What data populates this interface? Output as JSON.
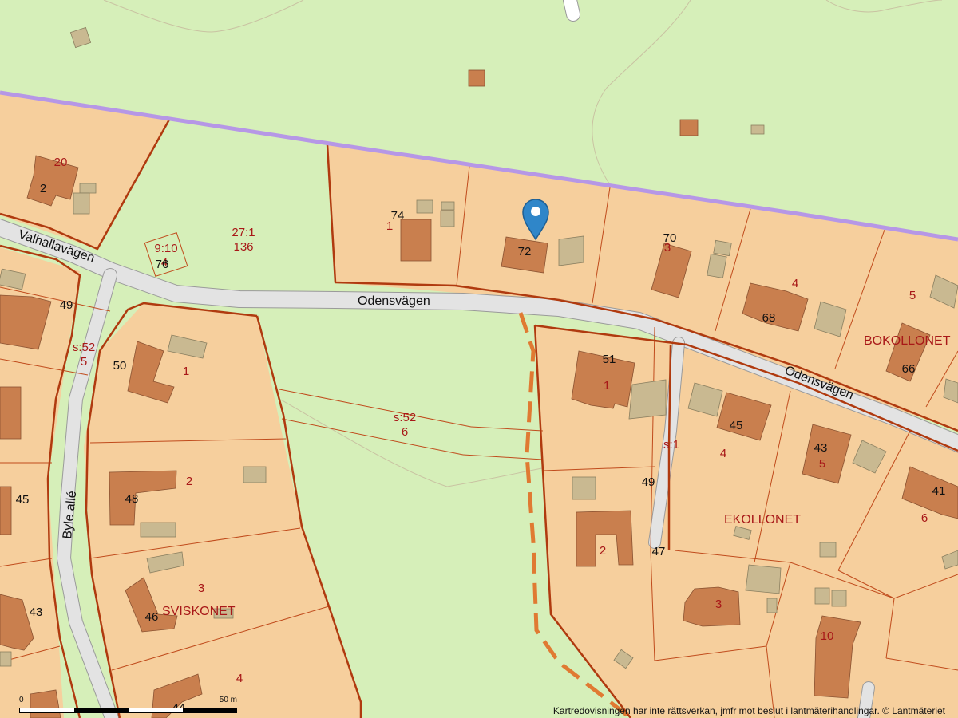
{
  "roads": {
    "valhallavagen": "Valhallavägen",
    "odensvagen_west": "Odensvägen",
    "odensvagen_east": "Odensvägen",
    "byle_alle": "Byle allé"
  },
  "blocks": {
    "bokkollonet": "BOKOLLONET",
    "ekollonet": "EKOLLONET",
    "sviskonet": "SVISKONET"
  },
  "parcels": [
    {
      "id": "p20",
      "text": "20"
    },
    {
      "id": "p27-1",
      "text": "27:1"
    },
    {
      "id": "p136",
      "text": "136"
    },
    {
      "id": "p9-10",
      "text": "9:10"
    },
    {
      "id": "p4a",
      "text": "4"
    },
    {
      "id": "p1a",
      "text": "1"
    },
    {
      "id": "p3a",
      "text": "3"
    },
    {
      "id": "p4b",
      "text": "4"
    },
    {
      "id": "p5a",
      "text": "5"
    },
    {
      "id": "p1b",
      "text": "1"
    },
    {
      "id": "p1c",
      "text": "1"
    },
    {
      "id": "ps52a",
      "text": "s:52"
    },
    {
      "id": "p5b",
      "text": "5"
    },
    {
      "id": "ps52b",
      "text": "s:52"
    },
    {
      "id": "p6a",
      "text": "6"
    },
    {
      "id": "ps1",
      "text": "s:1"
    },
    {
      "id": "p4c",
      "text": "4"
    },
    {
      "id": "p5c",
      "text": "5"
    },
    {
      "id": "p6b",
      "text": "6"
    },
    {
      "id": "p2a",
      "text": "2"
    },
    {
      "id": "p2b",
      "text": "2"
    },
    {
      "id": "p3b",
      "text": "3"
    },
    {
      "id": "p3c",
      "text": "3"
    },
    {
      "id": "p10",
      "text": "10"
    },
    {
      "id": "p4d",
      "text": "4"
    }
  ],
  "addresses": [
    {
      "id": "a2",
      "text": "2"
    },
    {
      "id": "a74",
      "text": "74"
    },
    {
      "id": "a72",
      "text": "72"
    },
    {
      "id": "a70",
      "text": "70"
    },
    {
      "id": "a76",
      "text": "76"
    },
    {
      "id": "a49a",
      "text": "49"
    },
    {
      "id": "a68",
      "text": "68"
    },
    {
      "id": "a66",
      "text": "66"
    },
    {
      "id": "a50",
      "text": "50"
    },
    {
      "id": "a51",
      "text": "51"
    },
    {
      "id": "a45a",
      "text": "45"
    },
    {
      "id": "a43a",
      "text": "43"
    },
    {
      "id": "a41",
      "text": "41"
    },
    {
      "id": "a45b",
      "text": "45"
    },
    {
      "id": "a48",
      "text": "48"
    },
    {
      "id": "a49b",
      "text": "49"
    },
    {
      "id": "a47",
      "text": "47"
    },
    {
      "id": "a46",
      "text": "46"
    },
    {
      "id": "a43b",
      "text": "43"
    },
    {
      "id": "a44",
      "text": "44"
    }
  ],
  "scale": {
    "start": "0",
    "end": "50 m"
  },
  "attribution": "Kartredovisningen har inte rättsverkan, jmfr mot beslut i lantmäterihandlingar. © Lantmäteriet",
  "colors": {
    "green_area": "#d6efb9",
    "property": "#f6cf9d",
    "building": "#c97f4e",
    "outbuilding": "#c9b991",
    "road": "#e3e3e3",
    "block_border": "#b03a0f",
    "municipal_border": "#b697e6",
    "path": "#e07a32",
    "marker": "#2f86c9"
  },
  "marker": {
    "icon": "map-pin-icon"
  }
}
